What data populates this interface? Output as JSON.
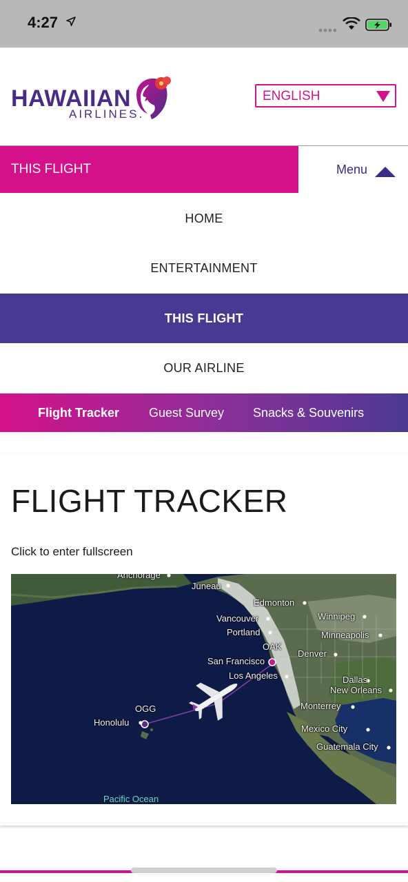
{
  "status_bar": {
    "time": "4:27",
    "icons": [
      "location-arrow-icon",
      "signal-dots-icon",
      "wifi-icon",
      "battery-charging-icon"
    ]
  },
  "header": {
    "logo": {
      "word": "HAWAIIAN",
      "sub": "AIRLINES."
    },
    "language": {
      "selected": "ENGLISH"
    }
  },
  "flight_bar": {
    "label": "THIS FLIGHT",
    "menu_label": "Menu"
  },
  "nav": {
    "items": [
      "HOME",
      "ENTERTAINMENT",
      "THIS FLIGHT",
      "OUR AIRLINE"
    ],
    "active": "THIS FLIGHT"
  },
  "subnav": {
    "items": [
      "Flight Tracker",
      "Guest Survey",
      "Snacks & Souvenirs"
    ],
    "active": "Flight Tracker"
  },
  "content": {
    "title": "FLIGHT TRACKER",
    "hint": "Click to enter fullscreen",
    "map": {
      "cities": [
        "Anchorage",
        "Juneau",
        "Edmonton",
        "Vancouver",
        "Winnipeg",
        "Portland",
        "Minneapolis",
        "OAK",
        "Denver",
        "San Francisco",
        "Los Angeles",
        "Dallas",
        "New Orleans",
        "Monterrey",
        "Mexico City",
        "Guatemala City",
        "OGG",
        "Honolulu"
      ],
      "ocean_label": "Pacific Ocean"
    }
  },
  "colors": {
    "brand_magenta": "#d4118a",
    "brand_purple": "#483a92",
    "logo_purple": "#4a2b86"
  }
}
